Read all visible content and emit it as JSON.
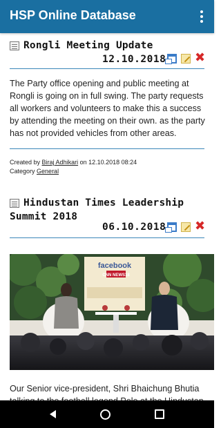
{
  "app": {
    "title": "HSP Online Database"
  },
  "posts": [
    {
      "title": "Rongli Meeting Update",
      "date": "12.10.2018",
      "body": "The Party office opening and public meeting at Rongli is going on in full swing. The party requests all workers and volunteers to make this a success by attending the meeting on their own. as the party has not provided vehicles from other areas.",
      "created_prefix": "Created by",
      "author": "Biraj Adhikari",
      "created_on": "on 12.10.2018 08:24",
      "category_label": "Category",
      "category": "General"
    },
    {
      "title_line1": "Hindustan Times Leadership",
      "title_line2": "Summit 2018",
      "date": "06.10.2018",
      "photo_backdrop_text": "facebook",
      "photo_logo_text": "CNN NEWS18",
      "body": "Our Senior vice-president, Shri Bhaichung Bhutia talking to the football legend Pele at the Hindustan"
    }
  ],
  "icons": {
    "overflow": "overflow-menu-icon",
    "doc": "document-icon",
    "view": "window-icon",
    "edit": "edit-icon",
    "delete": "delete-icon"
  },
  "colors": {
    "appbar": "#1a6fa1",
    "accent_line": "#3a86b8",
    "delete": "#d62828"
  }
}
